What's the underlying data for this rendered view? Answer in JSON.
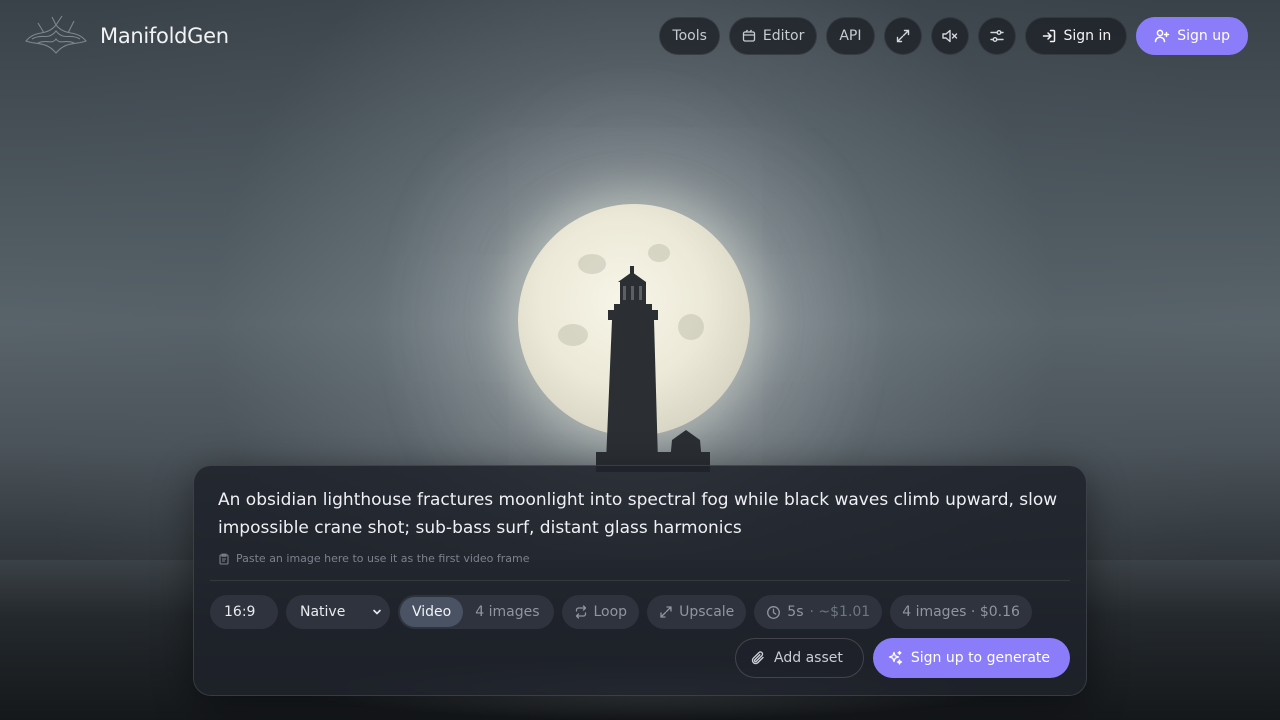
{
  "app": {
    "name": "ManifoldGen"
  },
  "nav": {
    "tools_label": "Tools",
    "editor_label": "Editor",
    "api_label": "API",
    "signin_label": "Sign in",
    "signup_label": "Sign up"
  },
  "composer": {
    "prompt": "An obsidian lighthouse fractures moonlight into spectral fog while black waves climb upward, slow impossible crane shot; sub-bass surf, distant glass harmonics",
    "hint": "Paste an image here to use it as the first video frame",
    "aspect_ratio": "16:9",
    "resolution": "Native",
    "mode_video": "Video",
    "mode_images": "4 images",
    "active_mode": "Video",
    "loop_label": "Loop",
    "upscale_label": "Upscale",
    "duration": "5s",
    "duration_cost": "· ~$1.01",
    "images_cost": "4 images · $0.16",
    "add_asset_label": "Add asset",
    "generate_label": "Sign up to generate"
  },
  "colors": {
    "accent": "#8b7df9"
  },
  "icons": [
    "logo-icon",
    "editor-icon",
    "fullscreen-icon",
    "mute-icon",
    "settings-icon",
    "signin-icon",
    "user-plus-icon",
    "paperclip-icon",
    "sparkles-icon",
    "loop-icon",
    "upscale-icon",
    "clock-icon",
    "image-paste-icon",
    "chevron-down-icon"
  ]
}
